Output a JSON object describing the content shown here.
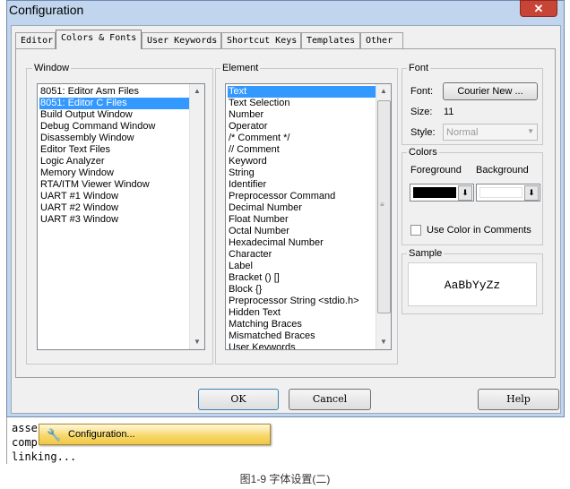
{
  "window": {
    "title": "Configuration",
    "close_glyph": "✕"
  },
  "tabs": [
    {
      "label": "Editor"
    },
    {
      "label": "Colors & Fonts",
      "active": true
    },
    {
      "label": "User Keywords"
    },
    {
      "label": "Shortcut Keys"
    },
    {
      "label": "Templates"
    },
    {
      "label": "Other"
    }
  ],
  "window_group": {
    "label": "Window",
    "items": [
      "8051: Editor Asm Files",
      "8051: Editor C Files",
      "Build Output Window",
      "Debug Command Window",
      "Disassembly Window",
      "Editor Text Files",
      "Logic Analyzer",
      "Memory Window",
      "RTA/ITM Viewer Window",
      "UART #1 Window",
      "UART #2 Window",
      "UART #3 Window"
    ],
    "selected": "8051: Editor C Files"
  },
  "element_group": {
    "label": "Element",
    "items": [
      "Text",
      "Text Selection",
      "Number",
      "Operator",
      "/* Comment */",
      "// Comment",
      "Keyword",
      "String",
      "Identifier",
      "Preprocessor Command",
      "Decimal Number",
      "Float Number",
      "Octal Number",
      "Hexadecimal Number",
      "Character",
      "Label",
      "Bracket () []",
      "Block {}",
      "Preprocessor String <stdio.h>",
      "Hidden Text",
      "Matching Braces",
      "Mismatched Braces",
      "User Keywords"
    ],
    "selected": "Text"
  },
  "font_group": {
    "label": "Font",
    "font_label": "Font:",
    "font_button": "Courier New ...",
    "size_label": "Size:",
    "size_value": "11",
    "style_label": "Style:",
    "style_value": "Normal"
  },
  "colors_group": {
    "label": "Colors",
    "foreground_label": "Foreground",
    "background_label": "Background",
    "foreground_color": "#000000",
    "background_color": "#ffffff",
    "use_color_in_comments_label": "Use Color in Comments",
    "use_color_in_comments": false
  },
  "sample_group": {
    "label": "Sample",
    "text": "AaBbYyZz"
  },
  "buttons": {
    "ok": "OK",
    "cancel": "Cancel",
    "help": "Help"
  },
  "output": {
    "lines": [
      "asse",
      "comp",
      "linking..."
    ]
  },
  "popup_menu": {
    "item": "Configuration..."
  },
  "caption": "图1-9 字体设置(二)"
}
